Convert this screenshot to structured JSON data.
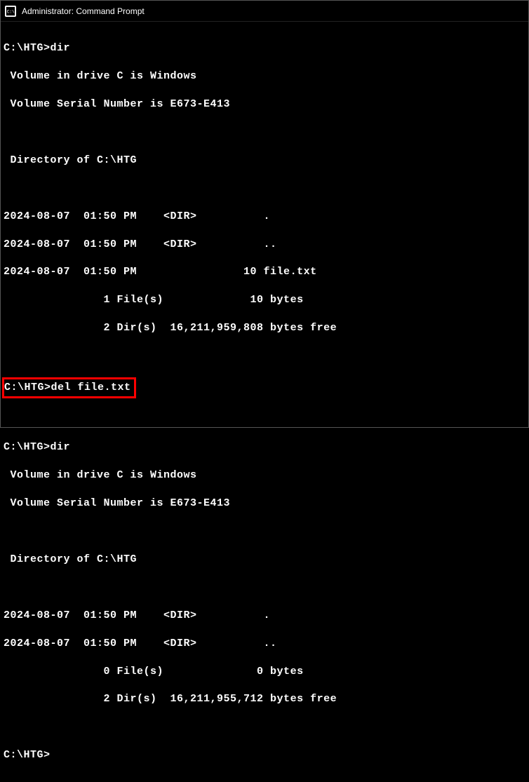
{
  "title": "Administrator: Command Prompt",
  "session": {
    "prompt1": "C:\\HTG>",
    "cmd1": "dir",
    "out1_l1": " Volume in drive C is Windows",
    "out1_l2": " Volume Serial Number is E673-E413",
    "out1_l3": " Directory of C:\\HTG",
    "out1_l4": "2024-08-07  01:50 PM    <DIR>          .",
    "out1_l5": "2024-08-07  01:50 PM    <DIR>          ..",
    "out1_l6": "2024-08-07  01:50 PM                10 file.txt",
    "out1_l7": "               1 File(s)             10 bytes",
    "out1_l8": "               2 Dir(s)  16,211,959,808 bytes free",
    "prompt2": "C:\\HTG>",
    "cmd2": "del file.txt",
    "prompt3": "C:\\HTG>",
    "cmd3": "dir",
    "out3_l1": " Volume in drive C is Windows",
    "out3_l2": " Volume Serial Number is E673-E413",
    "out3_l3": " Directory of C:\\HTG",
    "out3_l4": "2024-08-07  01:50 PM    <DIR>          .",
    "out3_l5": "2024-08-07  01:50 PM    <DIR>          ..",
    "out3_l6": "               0 File(s)              0 bytes",
    "out3_l7": "               2 Dir(s)  16,211,955,712 bytes free",
    "prompt4": "C:\\HTG>"
  }
}
